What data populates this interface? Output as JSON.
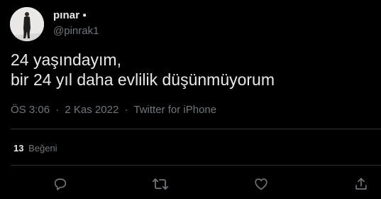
{
  "user": {
    "display_name": "pınar ▪",
    "handle": "@pinrak1"
  },
  "tweet": {
    "text_lines": [
      "24 yaşındayım,",
      "bir 24 yıl daha evlilik düşünmüyorum"
    ]
  },
  "meta": {
    "time": "ÖS 3:06",
    "separator1": "·",
    "date": "2 Kas 2022",
    "separator2": "·",
    "source": "Twitter for iPhone"
  },
  "stats": {
    "likes_count": "13",
    "likes_label": "Beğeni"
  },
  "actions": [
    {
      "icon": "reply-icon"
    },
    {
      "icon": "retweet-icon"
    },
    {
      "icon": "like-icon"
    },
    {
      "icon": "share-icon"
    }
  ],
  "colors": {
    "background": "#000000",
    "primary_text": "#e7e9ea",
    "secondary_text": "#71767b",
    "divider": "#2f3336"
  }
}
